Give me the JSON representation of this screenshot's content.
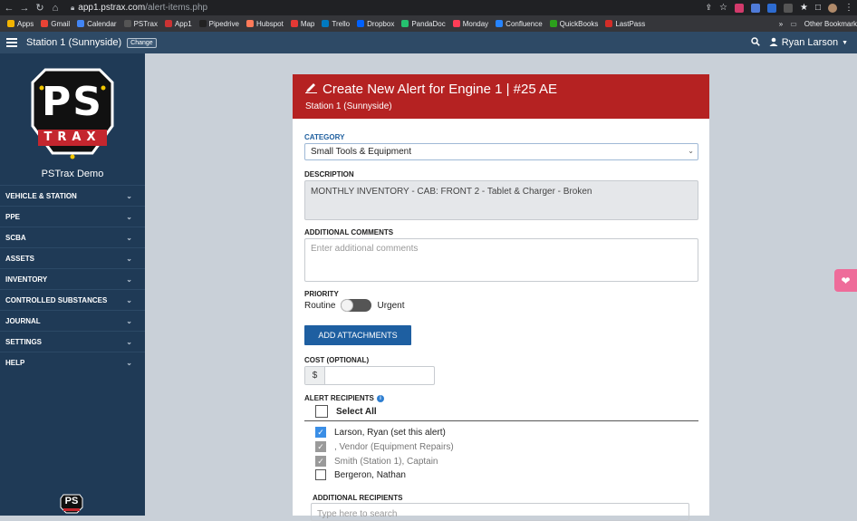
{
  "browser": {
    "url_host": "app1.pstrax.com",
    "url_path": "/alert-items.php",
    "bookmarks": [
      "Apps",
      "Gmail",
      "Calendar",
      "PSTrax",
      "App1",
      "Pipedrive",
      "Hubspot",
      "Map",
      "Trello",
      "Dropbox",
      "PandaDoc",
      "Monday",
      "Confluence",
      "QuickBooks",
      "LastPass"
    ],
    "bookmark_colors": [
      "#f4b400",
      "#ea4335",
      "#4285f4",
      "#555555",
      "#cc3333",
      "#222222",
      "#ff7a59",
      "#e53935",
      "#0079bf",
      "#0061fe",
      "#25c16f",
      "#ff3d57",
      "#2684ff",
      "#2ca01c",
      "#d32d27"
    ],
    "more_label": "»",
    "other_bookmarks": "Other Bookmark"
  },
  "topbar": {
    "station": "Station 1 (Sunnyside)",
    "change_label": "Change",
    "user": "Ryan Larson"
  },
  "sidebar": {
    "org_name": "PSTrax Demo",
    "logo_text": "PS",
    "logo_subtext": "TRAX",
    "bottom_logo_text": "PS",
    "items": [
      {
        "label": "VEHICLE & STATION"
      },
      {
        "label": "PPE"
      },
      {
        "label": "SCBA"
      },
      {
        "label": "ASSETS"
      },
      {
        "label": "INVENTORY"
      },
      {
        "label": "CONTROLLED SUBSTANCES"
      },
      {
        "label": "JOURNAL"
      },
      {
        "label": "SETTINGS"
      },
      {
        "label": "HELP"
      }
    ]
  },
  "form": {
    "title": "Create New Alert for Engine 1 | #25 AE",
    "subtitle": "Station 1 (Sunnyside)",
    "category_label": "CATEGORY",
    "category_value": "Small Tools & Equipment",
    "description_label": "DESCRIPTION",
    "description_value": "MONTHLY INVENTORY - CAB: FRONT 2 - Tablet & Charger - Broken",
    "comments_label": "ADDITIONAL COMMENTS",
    "comments_placeholder": "Enter additional comments",
    "priority_label": "PRIORITY",
    "priority_left": "Routine",
    "priority_right": "Urgent",
    "attach_label": "ADD ATTACHMENTS",
    "cost_label": "COST (OPTIONAL)",
    "cost_prefix": "$",
    "cost_value": "",
    "recipients_label": "ALERT RECIPIENTS",
    "select_all": "Select All",
    "recipients": [
      {
        "name": "Larson, Ryan (set this alert)",
        "checked": true,
        "style": "blue"
      },
      {
        "name": ", Vendor (Equipment Repairs)",
        "checked": true,
        "style": "grey"
      },
      {
        "name": "Smith (Station 1), Captain",
        "checked": true,
        "style": "grey"
      },
      {
        "name": "Bergeron, Nathan",
        "checked": false,
        "style": "none"
      }
    ],
    "additional_recipients_label": "ADDITIONAL RECIPIENTS",
    "search_placeholder": "Type here to search"
  },
  "colors": {
    "header_red": "#b52222",
    "sidebar_bg": "#1f3a56",
    "topbar_bg": "#2e4a66",
    "button_blue": "#1e5fa1",
    "heart_pink": "#ee6c9a"
  }
}
